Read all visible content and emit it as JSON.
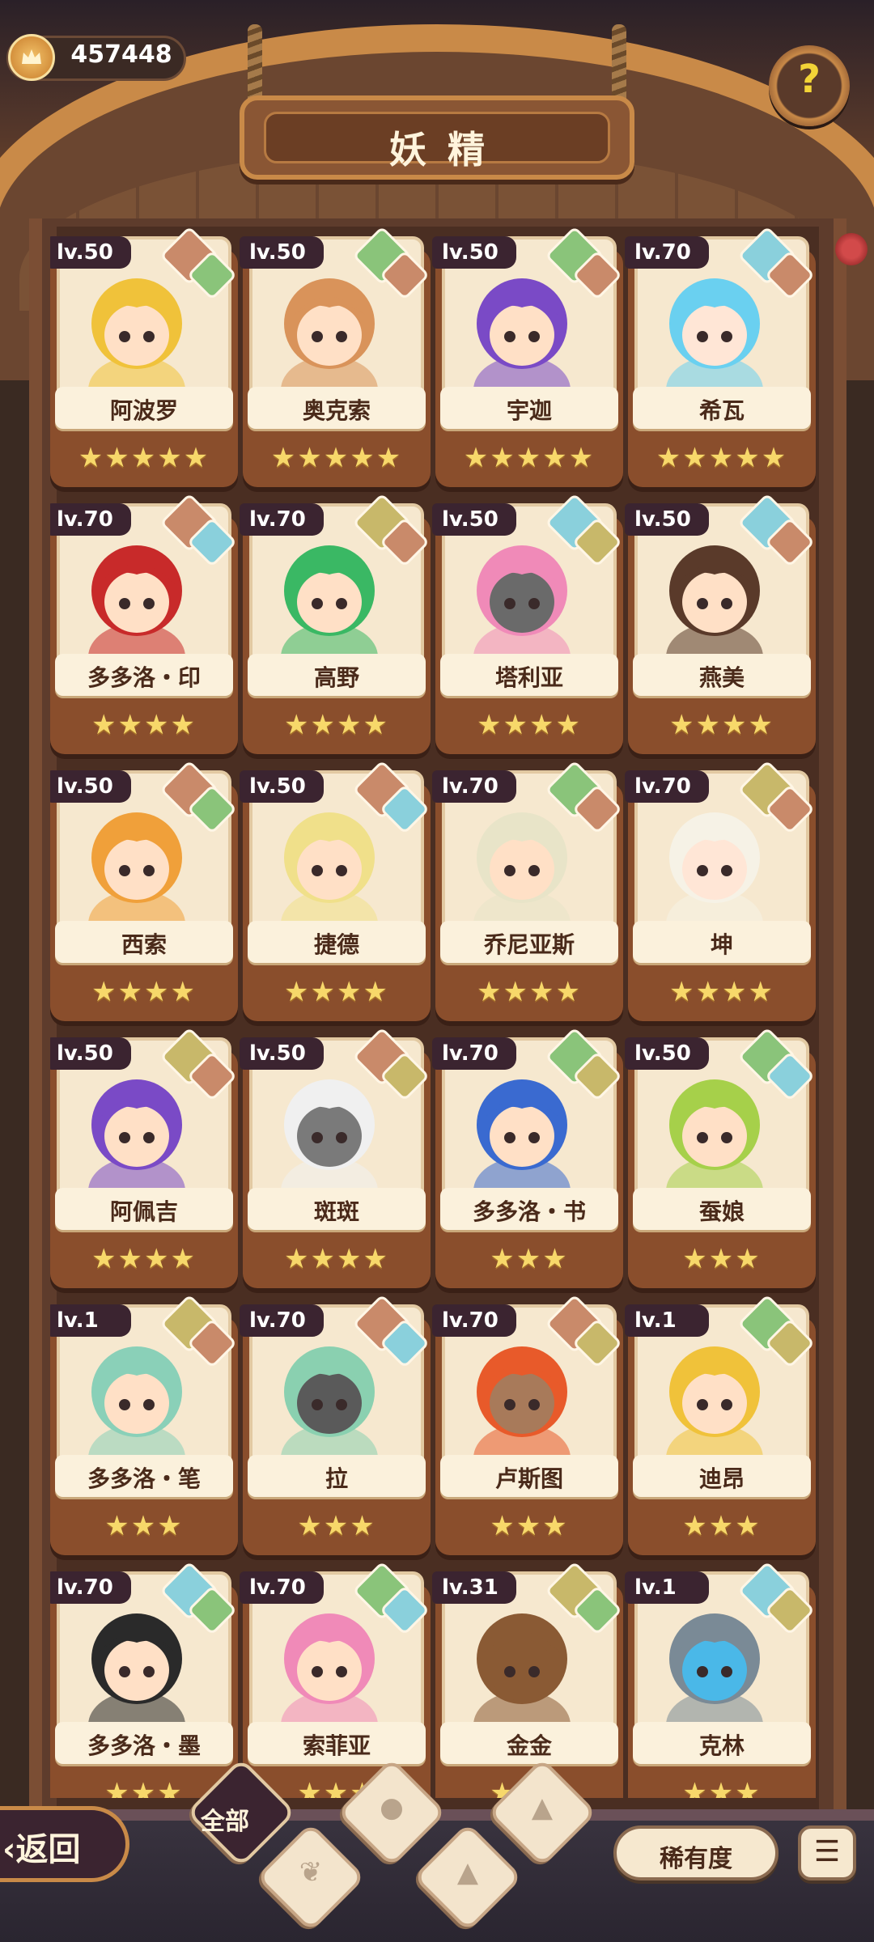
{
  "currency": {
    "icon": "crown-coin-icon",
    "value": "457448"
  },
  "title": "妖精",
  "help_icon": "seedling-question-icon",
  "fairies": [
    {
      "level": "lv.50",
      "name": "阿波罗",
      "stars": "★★★★★",
      "elem1": "#c98a6a",
      "elem2": "#8ac47a",
      "hair": "#f0c23a",
      "skin": "#ffe0c6"
    },
    {
      "level": "lv.50",
      "name": "奥克索",
      "stars": "★★★★★",
      "elem1": "#8ac47a",
      "elem2": "#c98a6a",
      "hair": "#d9935a",
      "skin": "#ffe0c6"
    },
    {
      "level": "lv.50",
      "name": "宇迦",
      "stars": "★★★★★",
      "elem1": "#8ac47a",
      "elem2": "#c98a6a",
      "hair": "#7a4ac6",
      "skin": "#ffe0c6"
    },
    {
      "level": "lv.70",
      "name": "希瓦",
      "stars": "★★★★★",
      "elem1": "#8ad0dc",
      "elem2": "#c98a6a",
      "hair": "#6ad0f0",
      "skin": "#ffe6d6"
    },
    {
      "level": "lv.70",
      "name": "多多洛・印",
      "stars": "★★★★",
      "elem1": "#c98a6a",
      "elem2": "#8ad0dc",
      "hair": "#c82a2a",
      "skin": "#ffe0c6"
    },
    {
      "level": "lv.70",
      "name": "高野",
      "stars": "★★★★",
      "elem1": "#c8b86a",
      "elem2": "#c98a6a",
      "hair": "#3ab864",
      "skin": "#ffe0c6"
    },
    {
      "level": "lv.50",
      "name": "塔利亚",
      "stars": "★★★★",
      "elem1": "#8ad0dc",
      "elem2": "#c8b86a",
      "hair": "#f08ab8",
      "skin": "#6a6a6a"
    },
    {
      "level": "lv.50",
      "name": "燕美",
      "stars": "★★★★",
      "elem1": "#8ad0dc",
      "elem2": "#c98a6a",
      "hair": "#5a3a2a",
      "skin": "#ffe0c6"
    },
    {
      "level": "lv.50",
      "name": "西索",
      "stars": "★★★★",
      "elem1": "#c98a6a",
      "elem2": "#8ac47a",
      "hair": "#f0a03a",
      "skin": "#ffe0c6"
    },
    {
      "level": "lv.50",
      "name": "捷德",
      "stars": "★★★★",
      "elem1": "#c98a6a",
      "elem2": "#8ad0dc",
      "hair": "#f0e08a",
      "skin": "#ffe0c6"
    },
    {
      "level": "lv.70",
      "name": "乔尼亚斯",
      "stars": "★★★★",
      "elem1": "#8ac47a",
      "elem2": "#c98a6a",
      "hair": "#e8e4c8",
      "skin": "#ffe0c6"
    },
    {
      "level": "lv.70",
      "name": "坤",
      "stars": "★★★★",
      "elem1": "#c8b86a",
      "elem2": "#c98a6a",
      "hair": "#f6f2e6",
      "skin": "#ffe6d6"
    },
    {
      "level": "lv.50",
      "name": "阿佩吉",
      "stars": "★★★★",
      "elem1": "#c8b86a",
      "elem2": "#c98a6a",
      "hair": "#7a4ac6",
      "skin": "#ffe0c6"
    },
    {
      "level": "lv.50",
      "name": "斑斑",
      "stars": "★★★★",
      "elem1": "#c98a6a",
      "elem2": "#c8b86a",
      "hair": "#f0f0f0",
      "skin": "#7a7a7a"
    },
    {
      "level": "lv.70",
      "name": "多多洛・书",
      "stars": "★★★",
      "elem1": "#8ac47a",
      "elem2": "#c8b86a",
      "hair": "#3a6ad0",
      "skin": "#ffe0c6"
    },
    {
      "level": "lv.50",
      "name": "蚕娘",
      "stars": "★★★",
      "elem1": "#8ac47a",
      "elem2": "#8ad0dc",
      "hair": "#a6d04a",
      "skin": "#ffe0c6"
    },
    {
      "level": "lv.1",
      "name": "多多洛・笔",
      "stars": "★★★",
      "elem1": "#c8b86a",
      "elem2": "#c98a6a",
      "hair": "#8ad0b8",
      "skin": "#ffe0c6"
    },
    {
      "level": "lv.70",
      "name": "拉",
      "stars": "★★★",
      "elem1": "#c98a6a",
      "elem2": "#8ad0dc",
      "hair": "#8ad0b0",
      "skin": "#5a5a5a"
    },
    {
      "level": "lv.70",
      "name": "卢斯图",
      "stars": "★★★",
      "elem1": "#c98a6a",
      "elem2": "#c8b86a",
      "hair": "#e85a2a",
      "skin": "#a87a5a"
    },
    {
      "level": "lv.1",
      "name": "迪昂",
      "stars": "★★★",
      "elem1": "#8ac47a",
      "elem2": "#c8b86a",
      "hair": "#f0c23a",
      "skin": "#ffe0c6"
    },
    {
      "level": "lv.70",
      "name": "多多洛・墨",
      "stars": "★★★",
      "elem1": "#8ad0dc",
      "elem2": "#8ac47a",
      "hair": "#2a2a2a",
      "skin": "#ffe0c6"
    },
    {
      "level": "lv.70",
      "name": "索菲亚",
      "stars": "★★★",
      "elem1": "#8ac47a",
      "elem2": "#8ad0dc",
      "hair": "#f08ab8",
      "skin": "#ffe0c6"
    },
    {
      "level": "lv.31",
      "name": "金金",
      "stars": "★★★",
      "elem1": "#c8b86a",
      "elem2": "#8ac47a",
      "hair": "#8a5a34",
      "skin": "#8a5a34"
    },
    {
      "level": "lv.1",
      "name": "克林",
      "stars": "★★★",
      "elem1": "#8ad0dc",
      "elem2": "#c8b86a",
      "hair": "#7a8a96",
      "skin": "#4ab8e8"
    }
  ],
  "footer": {
    "back_label": "返回",
    "tabs": [
      {
        "label": "全部",
        "icon": ""
      },
      {
        "label": "",
        "icon": "sprout-icon"
      },
      {
        "label": "",
        "icon": "water-drop-icon"
      },
      {
        "label": "",
        "icon": "earth-icon"
      },
      {
        "label": "",
        "icon": "fire-mountain-icon"
      }
    ],
    "sort_label": "稀有度",
    "order_icon": "sort-order-icon"
  }
}
